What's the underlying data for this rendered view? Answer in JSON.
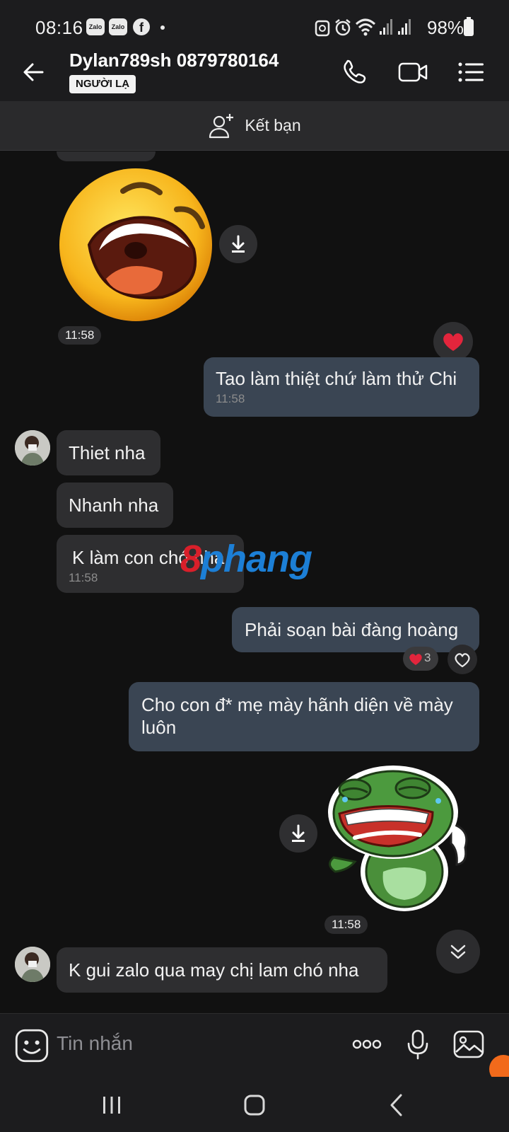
{
  "status_bar": {
    "time": "08:16",
    "app_icons": [
      "Zalo",
      "Zalo"
    ],
    "battery": "98%"
  },
  "header": {
    "contact_name": "Dylan789sh 0879780164",
    "badge": "NGƯỜI LẠ"
  },
  "add_friend": {
    "label": "Kết bạn"
  },
  "messages": {
    "sticker1_time": "11:58",
    "m1_text": "Tao làm thiệt chứ làm thử Chi",
    "m1_time": "11:58",
    "m2_text": "Thiet nha",
    "m3_text": "Nhanh nha",
    "m4_text": "K làm con chó nha",
    "m4_time": "11:58",
    "m5_text": "Phải soạn bài đàng hoàng",
    "m5_reaction_count": "3",
    "m6_text": "Cho con đ* mẹ mày hãnh diện về mày luôn",
    "sticker2_time": "11:58",
    "m7_text": "K gui zalo qua may chị lam chó nha"
  },
  "watermark": {
    "part1": "8",
    "part2": "phang"
  },
  "input": {
    "placeholder": "Tin nhắn"
  },
  "colors": {
    "background": "#111111",
    "bar": "#1c1c1e",
    "incoming_bubble": "#2e2e30",
    "outgoing_bubble": "#3a4553",
    "heart": "#e3253c"
  }
}
